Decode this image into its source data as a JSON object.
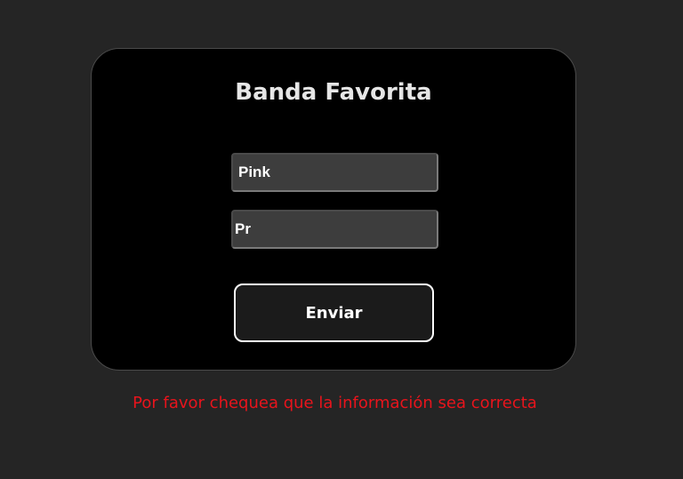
{
  "form": {
    "title": "Banda Favorita",
    "band_value": "Pink",
    "song_value": "Pr",
    "submit_label": "Enviar"
  },
  "error_message": "Por favor chequea que la información sea correcta",
  "colors": {
    "page_background": "#252525",
    "card_background": "#000000",
    "input_background": "#3d3d3d",
    "error_text": "#e8141c",
    "button_border": "#ffffff"
  }
}
